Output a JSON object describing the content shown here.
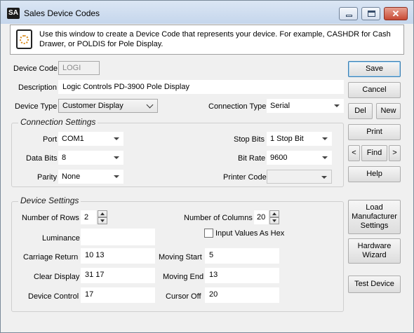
{
  "window": {
    "app_icon_text": "SA",
    "title": "Sales Device Codes",
    "close_glyph": "✕"
  },
  "info": {
    "text": "Use this window to create a Device Code that represents your device. For example, CASHDR for Cash Drawer, or POLDIS for Pole Display."
  },
  "header": {
    "device_code_label": "Device Code",
    "device_code_value": "LOGI",
    "description_label": "Description",
    "description_value": "Logic Controls PD-3900 Pole Display",
    "device_type_label": "Device Type",
    "device_type_value": "Customer Display",
    "connection_type_label": "Connection Type",
    "connection_type_value": "Serial"
  },
  "connection_settings": {
    "title": "Connection Settings",
    "port_label": "Port",
    "port_value": "COM1",
    "data_bits_label": "Data Bits",
    "data_bits_value": "8",
    "parity_label": "Parity",
    "parity_value": "None",
    "stop_bits_label": "Stop Bits",
    "stop_bits_value": "1 Stop Bit",
    "bit_rate_label": "Bit Rate",
    "bit_rate_value": "9600",
    "printer_code_label": "Printer Code",
    "printer_code_value": ""
  },
  "device_settings": {
    "title": "Device Settings",
    "rows_label": "Number of Rows",
    "rows_value": "2",
    "columns_label": "Number of Columns",
    "columns_value": "20",
    "luminance_label": "Luminance",
    "luminance_value": "",
    "hex_label": "Input Values As Hex",
    "hex_checked": false,
    "carriage_return_label": "Carriage Return",
    "carriage_return_value": "10 13",
    "clear_display_label": "Clear Display",
    "clear_display_value": "31 17",
    "device_control_label": "Device Control",
    "device_control_value": "17",
    "moving_start_label": "Moving Start",
    "moving_start_value": "5",
    "moving_end_label": "Moving End",
    "moving_end_value": "13",
    "cursor_off_label": "Cursor Off",
    "cursor_off_value": "20"
  },
  "buttons": {
    "save": "Save",
    "cancel": "Cancel",
    "del": "Del",
    "new": "New",
    "print": "Print",
    "prev": "<",
    "find": "Find",
    "next": ">",
    "help": "Help",
    "load_manufacturer": "Load Manufacturer Settings",
    "hardware_wizard": "Hardware Wizard",
    "test_device": "Test Device"
  },
  "colors": {
    "window_bg": "#f0f0f0",
    "titlebar": "#c5d6ec",
    "default_button_border": "#3c7fb1",
    "close_button": "#c74a35"
  }
}
